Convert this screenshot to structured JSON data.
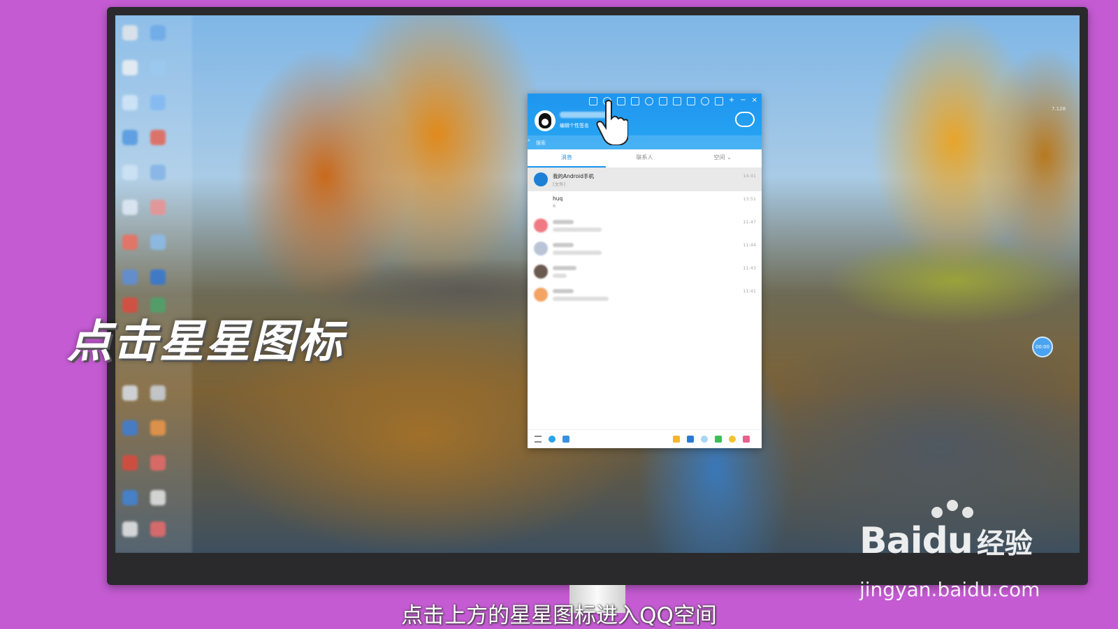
{
  "overlay": {
    "big_caption": "点击星星图标",
    "sub_caption": "点击上方的星星图标进入QQ空间"
  },
  "watermark": {
    "brand_latin": "Bai",
    "brand_du": "du",
    "brand_cn": "经验",
    "url": "jingyan.baidu.com"
  },
  "qq": {
    "signature": "编辑个性签名",
    "search_placeholder": "搜索",
    "tabs": [
      {
        "label": "消息",
        "active": true
      },
      {
        "label": "联系人",
        "active": false
      },
      {
        "label": "空间 ⌄",
        "active": false
      }
    ],
    "conversations": [
      {
        "title": "我的Android手机",
        "preview": "[文件]",
        "time": "14:41",
        "selected": true,
        "icon_color": "#1e7fd6"
      },
      {
        "title": "huq",
        "preview": "6",
        "time": "13:51",
        "selected": false,
        "icon_color": ""
      },
      {
        "title": "",
        "preview": "",
        "time": "11:47",
        "selected": false,
        "icon_color": "#f07a84"
      },
      {
        "title": "",
        "preview": "",
        "time": "11:44",
        "selected": false,
        "icon_color": "#b9c4d6"
      },
      {
        "title": "",
        "preview": "",
        "time": "11:43",
        "selected": false,
        "icon_color": "#6b5a50"
      },
      {
        "title": "",
        "preview": "",
        "time": "11:41",
        "selected": false,
        "icon_color": "#f3a463"
      }
    ]
  },
  "desktop": {
    "clock_bubble": "00:00",
    "side_text": "7.128"
  },
  "colors": {
    "qq_blue": "#1e95ef",
    "background": "#c45bd2"
  }
}
